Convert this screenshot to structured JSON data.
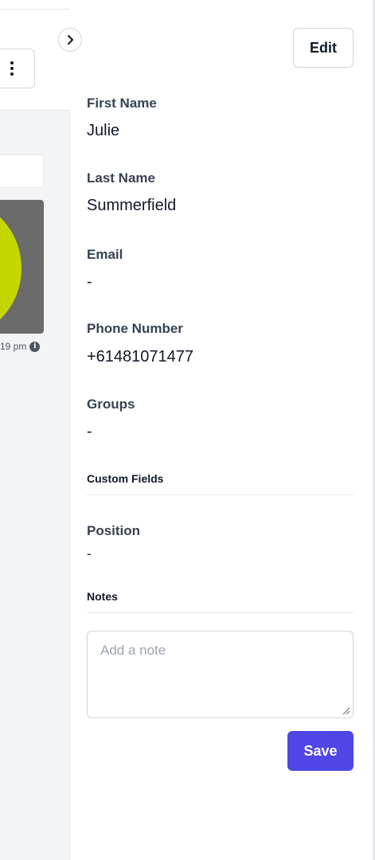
{
  "left_panel": {
    "media_time": "19 pm",
    "more_icon": "kebab-vertical-icon",
    "info_icon": "info-icon",
    "info_glyph": "i",
    "media_colors": {
      "background": "#6b6b6b",
      "circle": "#c3d600"
    }
  },
  "toggle": {
    "icon": "chevron-right-icon"
  },
  "details": {
    "edit_label": "Edit",
    "fields": [
      {
        "label": "First Name",
        "value": "Julie"
      },
      {
        "label": "Last Name",
        "value": "Summerfield"
      },
      {
        "label": "Email",
        "value": "-"
      },
      {
        "label": "Phone Number",
        "value": "+61481071477"
      },
      {
        "label": "Groups",
        "value": "-"
      }
    ],
    "custom_fields_title": "Custom Fields",
    "custom_fields": [
      {
        "label": "Position",
        "value": "-"
      }
    ],
    "notes_title": "Notes",
    "note_placeholder": "Add a note",
    "save_label": "Save"
  },
  "colors": {
    "accent": "#4f46e5",
    "panel_bg": "#f3f4f6",
    "border": "#d1d5db"
  }
}
